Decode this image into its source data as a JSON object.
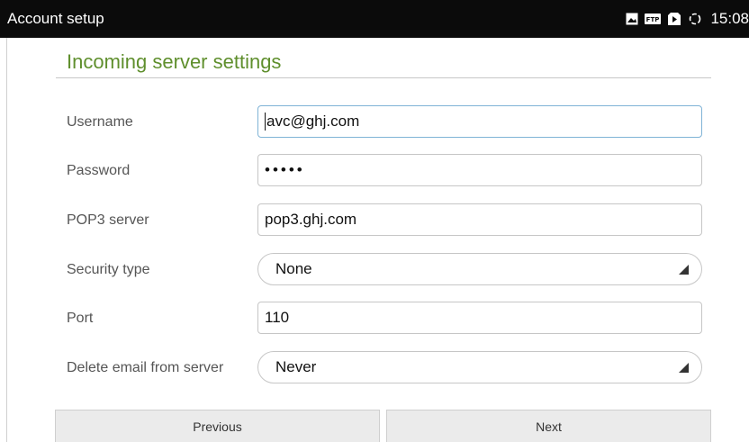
{
  "statusbar": {
    "title": "Account setup",
    "time": "15:08",
    "icons": [
      "image-icon",
      "ftp-icon",
      "download-icon",
      "sync-icon"
    ],
    "ftp_label": "FTP"
  },
  "section": {
    "title": "Incoming server settings"
  },
  "form": {
    "username": {
      "label": "Username",
      "value": "avc@ghj.com"
    },
    "password": {
      "label": "Password",
      "value": "•••••"
    },
    "pop3_server": {
      "label": "POP3 server",
      "value": "pop3.ghj.com"
    },
    "security_type": {
      "label": "Security type",
      "value": "None"
    },
    "port": {
      "label": "Port",
      "value": "110"
    },
    "delete_email": {
      "label": "Delete email from server",
      "value": "Never"
    }
  },
  "buttons": {
    "previous": "Previous",
    "next": "Next"
  },
  "colors": {
    "accent": "#5f8f2d",
    "statusbar": "#0b0b0b",
    "focus_border": "#7fb3d6"
  }
}
